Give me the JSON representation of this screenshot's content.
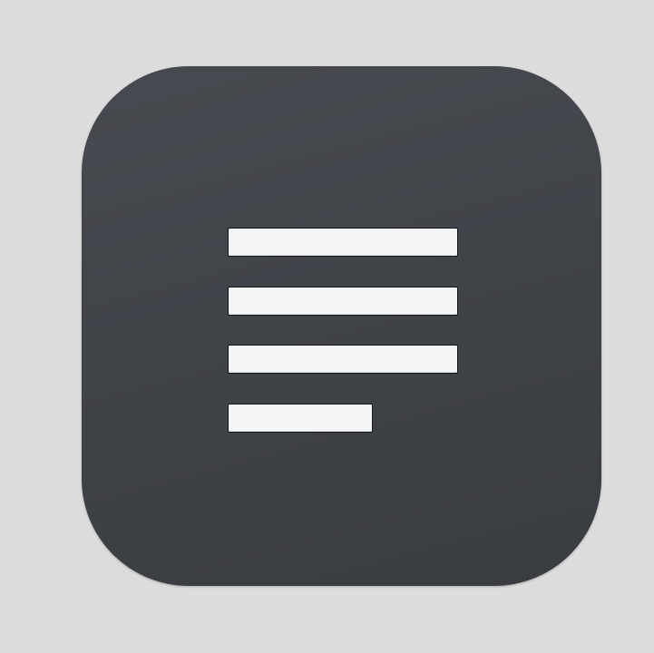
{
  "icon": {
    "name": "text-lines-icon",
    "line_count": 4,
    "colors": {
      "background": "#dcdcdc",
      "tile": "#41444a",
      "line_fill": "#f4f5f6",
      "line_outline": "#15171a"
    }
  }
}
